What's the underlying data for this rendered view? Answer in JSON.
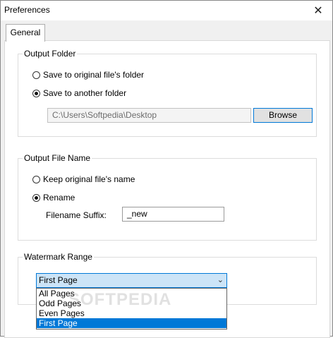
{
  "window": {
    "title": "Preferences",
    "close_glyph": "✕"
  },
  "tabs": [
    {
      "label": "General"
    }
  ],
  "output_folder": {
    "title": "Output Folder",
    "options": [
      {
        "label": "Save to original file's folder",
        "selected": false
      },
      {
        "label": "Save to another folder",
        "selected": true
      }
    ],
    "path_value": "C:\\Users\\Softpedia\\Desktop",
    "browse_label": "Browse"
  },
  "output_file_name": {
    "title": "Output File Name",
    "options": [
      {
        "label": "Keep original file's name",
        "selected": false
      },
      {
        "label": "Rename",
        "selected": true
      }
    ],
    "suffix_label": "Filename Suffix:",
    "suffix_value": "_new"
  },
  "watermark_range": {
    "title": "Watermark Range",
    "selected": "First Page",
    "options": [
      "All Pages",
      "Odd Pages",
      "Even Pages",
      "First Page"
    ]
  },
  "watermark_text": "SOFTPEDIA",
  "colors": {
    "accent": "#0078d7",
    "combo_bg": "#cce4f7",
    "button_bg": "#e1e1e1"
  }
}
